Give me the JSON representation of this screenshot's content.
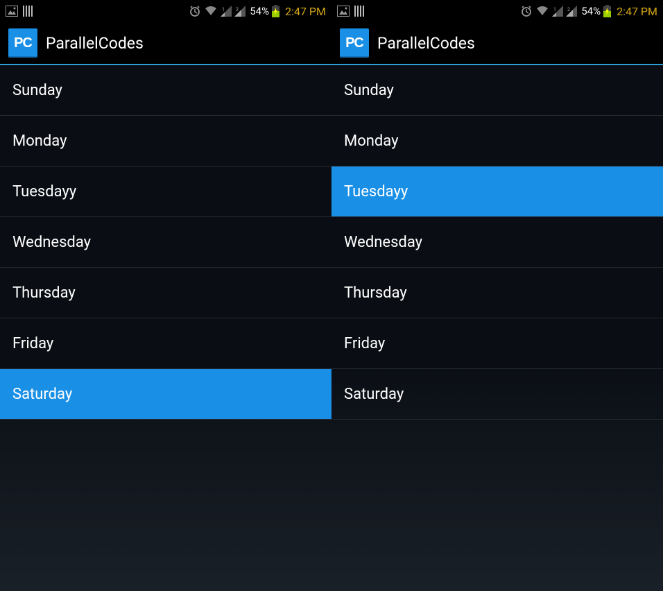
{
  "status": {
    "battery_pct": "54%",
    "time": "2:47 PM"
  },
  "app": {
    "icon_text": "PC",
    "title": "ParallelCodes"
  },
  "screens": [
    {
      "items": [
        {
          "label": "Sunday",
          "selected": false
        },
        {
          "label": "Monday",
          "selected": false
        },
        {
          "label": "Tuesdayy",
          "selected": false
        },
        {
          "label": "Wednesday",
          "selected": false
        },
        {
          "label": "Thursday",
          "selected": false
        },
        {
          "label": "Friday",
          "selected": false
        },
        {
          "label": "Saturday",
          "selected": true
        }
      ]
    },
    {
      "items": [
        {
          "label": "Sunday",
          "selected": false
        },
        {
          "label": "Monday",
          "selected": false
        },
        {
          "label": "Tuesdayy",
          "selected": true
        },
        {
          "label": "Wednesday",
          "selected": false
        },
        {
          "label": "Thursday",
          "selected": false
        },
        {
          "label": "Friday",
          "selected": false
        },
        {
          "label": "Saturday",
          "selected": false
        }
      ]
    }
  ]
}
